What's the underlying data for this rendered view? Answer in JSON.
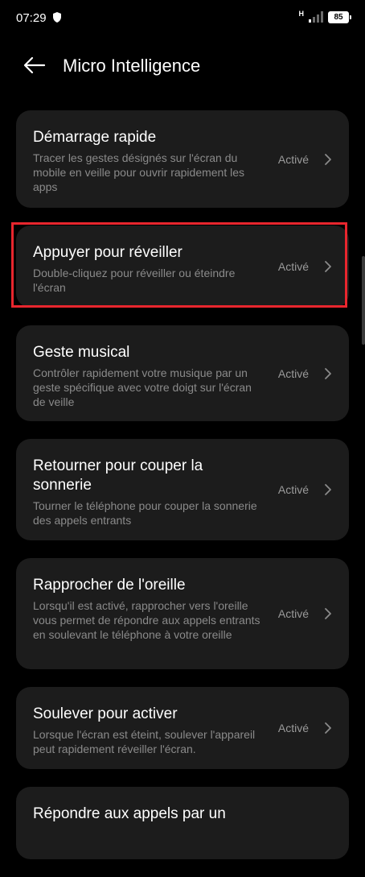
{
  "status_bar": {
    "time": "07:29",
    "network": "H",
    "battery": "85"
  },
  "header": {
    "title": "Micro Intelligence"
  },
  "settings": [
    {
      "title": "Démarrage rapide",
      "description": "Tracer les gestes désignés sur l'écran du mobile en veille pour ouvrir rapidement les apps",
      "status": "Activé"
    },
    {
      "title": "Appuyer pour réveiller",
      "description": "Double-cliquez pour réveiller ou éteindre l'écran",
      "status": "Activé"
    },
    {
      "title": "Geste musical",
      "description": "Contrôler rapidement votre musique par un geste spécifique avec votre doigt sur l'écran de veille",
      "status": "Activé"
    },
    {
      "title": "Retourner pour couper la sonnerie",
      "description": "Tourner le téléphone pour couper la sonnerie des appels entrants",
      "status": "Activé"
    },
    {
      "title": "Rapprocher de l'oreille",
      "description": "Lorsqu'il est activé, rapprocher vers l'oreille vous permet de répondre aux appels entrants en soulevant le téléphone à votre oreille",
      "status": "Activé"
    },
    {
      "title": "Soulever pour activer",
      "description": "Lorsque l'écran est éteint, soulever l'appareil peut rapidement réveiller l'écran.",
      "status": "Activé"
    },
    {
      "title": "Répondre aux appels par un",
      "description": "",
      "status": ""
    }
  ],
  "colors": {
    "background": "#000000",
    "card": "#1c1c1c",
    "description": "#8a8a8a",
    "status": "#9a9a9a",
    "highlight": "#e8262e"
  }
}
